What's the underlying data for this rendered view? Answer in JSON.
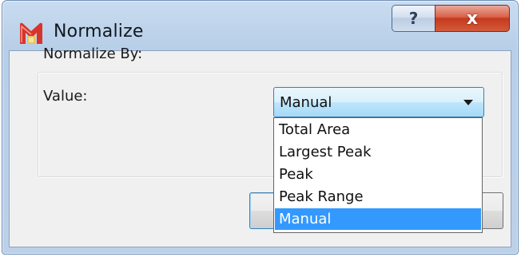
{
  "window": {
    "title": "Normalize",
    "help_glyph": "?",
    "close_glyph": "x"
  },
  "form": {
    "normalize_by_label": "Normalize By:",
    "value_label": "Value:"
  },
  "combo": {
    "selected": "Manual",
    "options": [
      "Total Area",
      "Largest Peak",
      "Peak",
      "Peak Range",
      "Manual"
    ],
    "selected_index": 4
  },
  "colors": {
    "titlebar": "#c9dcf0",
    "close_button": "#c53a1e",
    "selection": "#3399ff",
    "dialog_bg": "#f0f0f0"
  },
  "icons": {
    "app": "app-m-icon",
    "help": "help-icon",
    "close": "close-icon",
    "dropdown": "chevron-down-icon"
  }
}
